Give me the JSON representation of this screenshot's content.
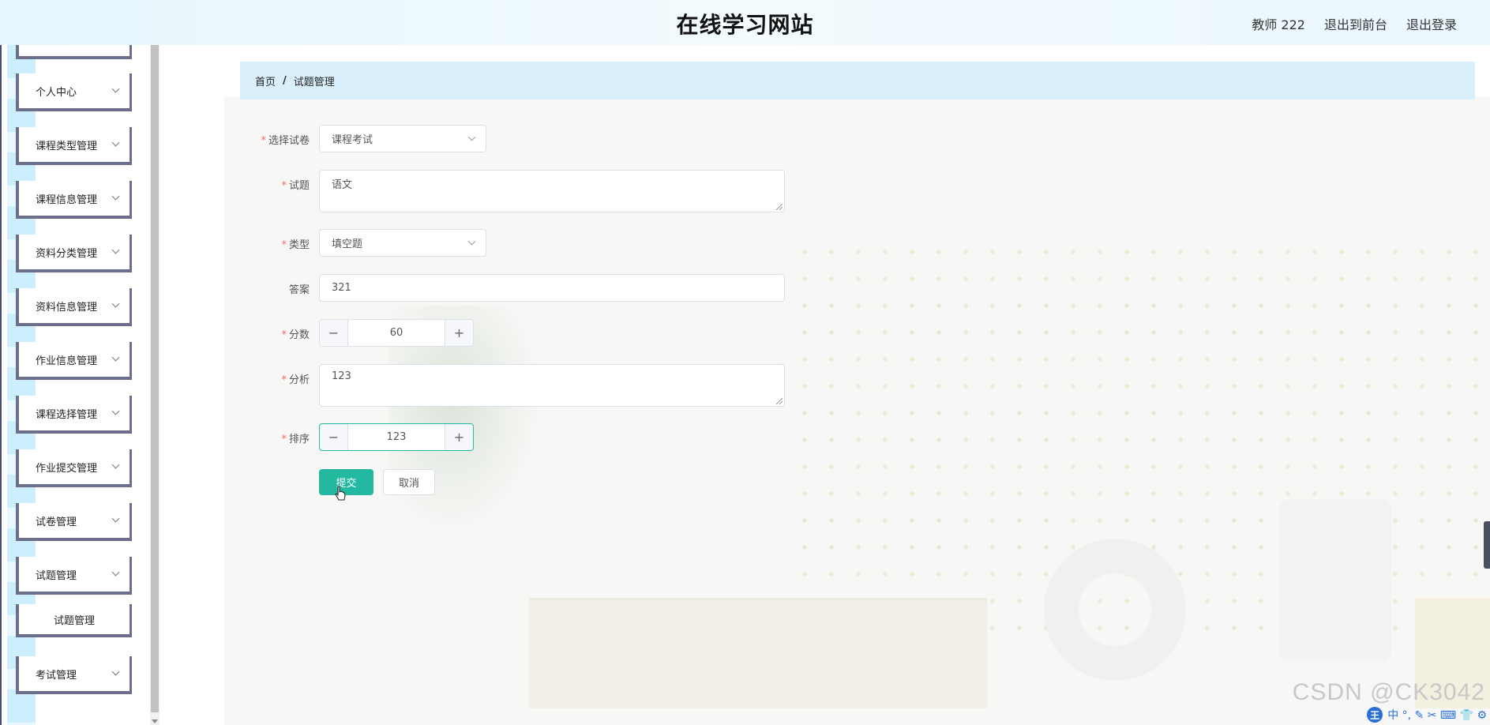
{
  "header": {
    "title": "在线学习网站",
    "user": "教师 222",
    "back_to_front": "退出到前台",
    "logout": "退出登录"
  },
  "sidebar": {
    "items": [
      {
        "label": "个人中心"
      },
      {
        "label": "课程类型管理"
      },
      {
        "label": "课程信息管理"
      },
      {
        "label": "资料分类管理"
      },
      {
        "label": "资料信息管理"
      },
      {
        "label": "作业信息管理"
      },
      {
        "label": "课程选择管理"
      },
      {
        "label": "作业提交管理"
      },
      {
        "label": "试卷管理"
      },
      {
        "label": "试题管理"
      },
      {
        "label": "试题管理"
      },
      {
        "label": "考试管理"
      }
    ]
  },
  "breadcrumb": {
    "home": "首页",
    "separator": "/",
    "current": "试题管理"
  },
  "form": {
    "paper": {
      "label": "选择试卷",
      "value": "课程考试"
    },
    "question": {
      "label": "试题",
      "value": "语文"
    },
    "type": {
      "label": "类型",
      "value": "填空题"
    },
    "answer": {
      "label": "答案",
      "value": "321"
    },
    "score": {
      "label": "分数",
      "value": "60",
      "minus": "−",
      "plus": "+"
    },
    "analysis": {
      "label": "分析",
      "value": "123"
    },
    "sort": {
      "label": "排序",
      "value": "123",
      "minus": "−",
      "plus": "+"
    },
    "submit": "提交",
    "cancel": "取消",
    "required_mark": "*"
  },
  "overlay": {
    "watermark": "CSDN @CK3042",
    "ime_logo": "王",
    "ime_text": "中 °, ✎ ✂ ⌨ 👕 ⚙"
  },
  "colors": {
    "accent": "#23b9a0",
    "header_bg": "#e6f6fd",
    "breadcrumb_bg": "#d9effb",
    "required": "#f56c6c"
  }
}
